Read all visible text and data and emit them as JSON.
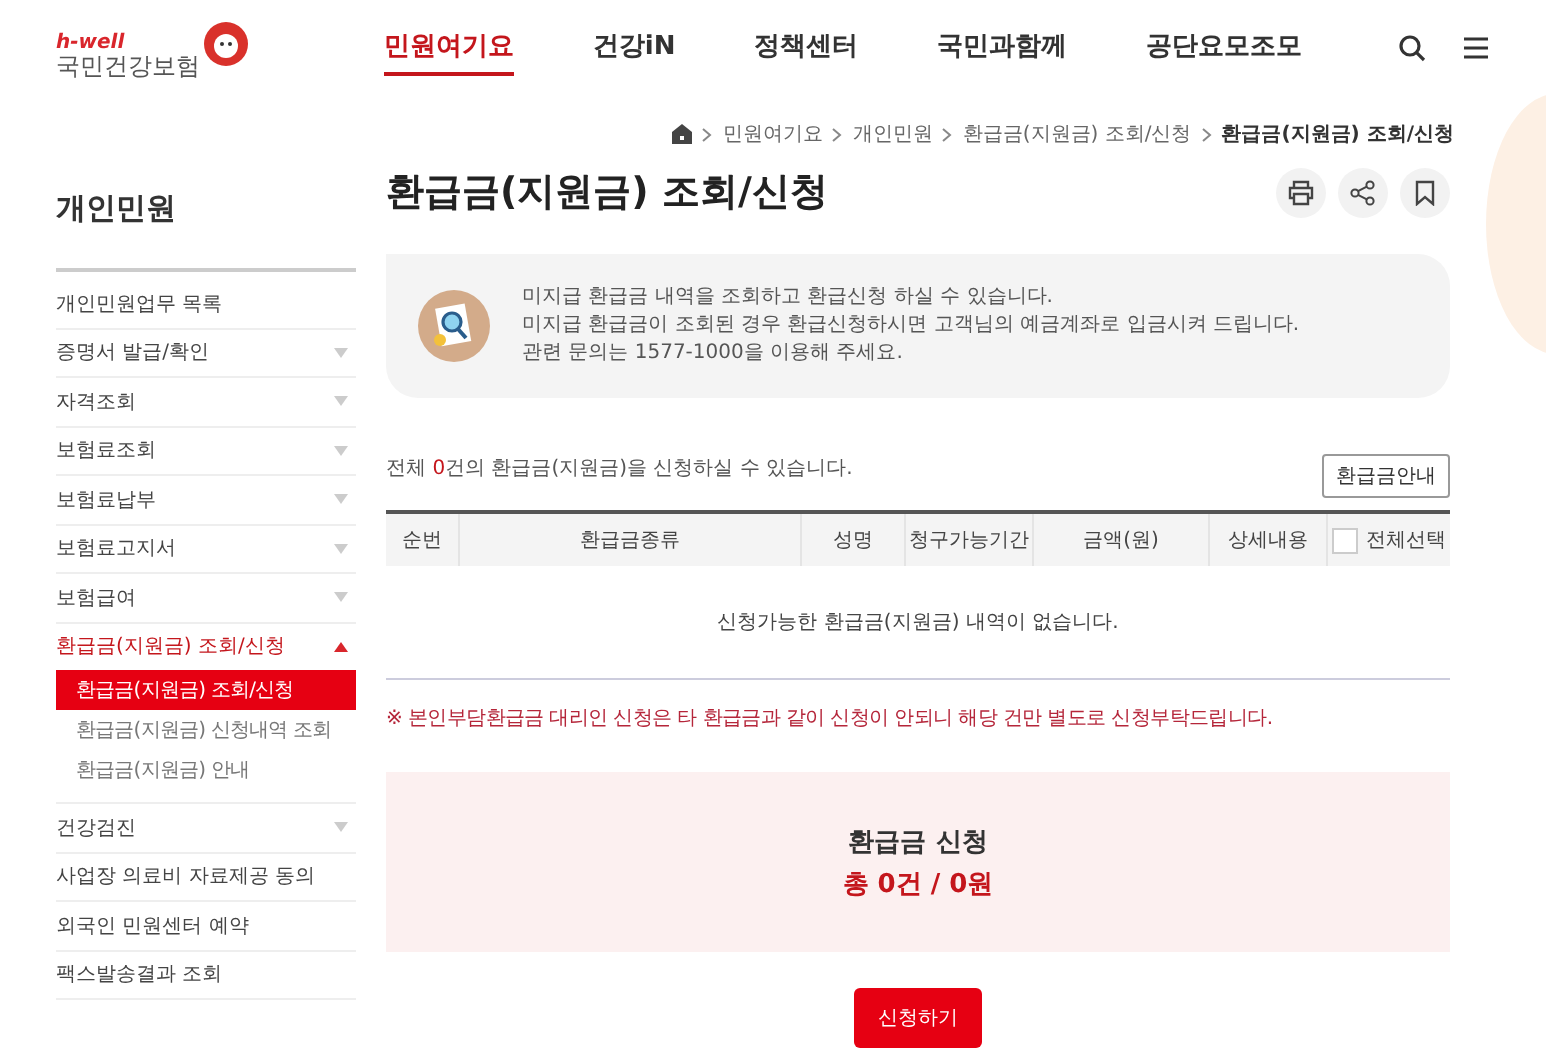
{
  "logo": {
    "tagline": "h-well",
    "name": "국민건강보험"
  },
  "nav": [
    {
      "label": "민원여기요",
      "selected": true
    },
    {
      "label": "건강iN",
      "selected": false
    },
    {
      "label": "정책센터",
      "selected": false
    },
    {
      "label": "국민과함께",
      "selected": false
    },
    {
      "label": "공단요모조모",
      "selected": false
    }
  ],
  "breadcrumb": [
    "민원여기요",
    "개인민원",
    "환급금(지원금) 조회/신청",
    "환급금(지원금) 조회/신청"
  ],
  "sidebar": {
    "title": "개인민원",
    "items": [
      {
        "label": "개인민원업무 목록",
        "expandable": false,
        "expanded": false
      },
      {
        "label": "증명서 발급/확인",
        "expandable": true,
        "expanded": false
      },
      {
        "label": "자격조회",
        "expandable": true,
        "expanded": false
      },
      {
        "label": "보험료조회",
        "expandable": true,
        "expanded": false
      },
      {
        "label": "보험료납부",
        "expandable": true,
        "expanded": false
      },
      {
        "label": "보험료고지서",
        "expandable": true,
        "expanded": false
      },
      {
        "label": "보험급여",
        "expandable": true,
        "expanded": false
      },
      {
        "label": "환급금(지원금) 조회/신청",
        "expandable": true,
        "expanded": true,
        "children": [
          {
            "label": "환급금(지원금) 조회/신청",
            "selected": true
          },
          {
            "label": "환급금(지원금) 신청내역 조회",
            "selected": false
          },
          {
            "label": "환급금(지원금) 안내",
            "selected": false
          }
        ]
      },
      {
        "label": "건강검진",
        "expandable": true,
        "expanded": false
      },
      {
        "label": "사업장 의료비 자료제공 동의",
        "expandable": false,
        "expanded": false
      },
      {
        "label": "외국인 민원센터 예약",
        "expandable": false,
        "expanded": false
      },
      {
        "label": "팩스발송결과 조회",
        "expandable": false,
        "expanded": false
      }
    ]
  },
  "page_title": "환급금(지원금) 조회/신청",
  "notice": [
    "미지급 환급금 내역을 조회하고 환급신청 하실 수 있습니다.",
    "미지급 환급금이 조회된 경우 환급신청하시면 고객님의 예금계좌로 입금시켜 드립니다.",
    "관련 문의는 1577-1000을 이용해 주세요."
  ],
  "count_text": {
    "prefix": "전체 ",
    "count": "0",
    "suffix": "건의 환급금(지원금)을 신청하실 수 있습니다."
  },
  "guide_button": "환급금안내",
  "table": {
    "columns": [
      "순번",
      "환급금종류",
      "성명",
      "청구가능기간",
      "금액(원)",
      "상세내용"
    ],
    "select_all": {
      "label": "전체선택",
      "checked": false
    },
    "empty_message": "신청가능한 환급금(지원금) 내역이 없습니다."
  },
  "warning": "※ 본인부담환급금 대리인 신청은 타 환급금과 같이 신청이 안되니 해당 건만 별도로 신청부탁드립니다.",
  "summary": {
    "title": "환급금 신청",
    "total": "총 0건 / 0원"
  },
  "apply_button": "신청하기"
}
